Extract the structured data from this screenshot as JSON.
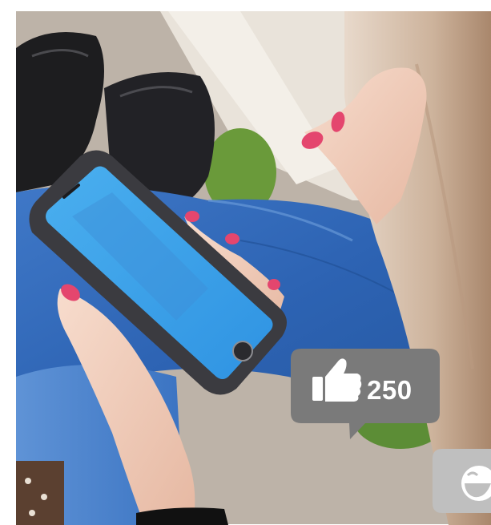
{
  "photo": {
    "subject": "woman-holding-smartphone",
    "screen_color": "#3ea7ef"
  },
  "like_bubble": {
    "icon": "thumbs-up-icon",
    "count": "250",
    "color": "#7a7a7a"
  },
  "emoji_bubble": {
    "icon": "laughing-face-icon",
    "color": "#bfbfbf"
  }
}
